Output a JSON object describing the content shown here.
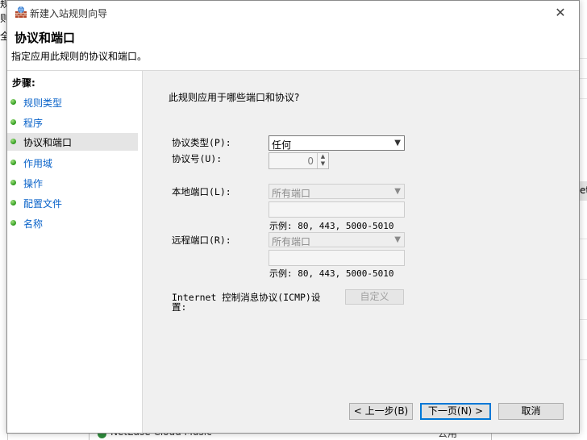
{
  "background": {
    "left_fragments": [
      "规",
      "则",
      "全"
    ],
    "right_fragment": "et",
    "bottom_app_name": "NetEase Cloud Music",
    "bottom_profile": "公用"
  },
  "dialog": {
    "title": "新建入站规则向导",
    "close_symbol": "✕",
    "header": {
      "title": "协议和端口",
      "description": "指定应用此规则的协议和端口。"
    },
    "steps": {
      "title": "步骤:",
      "items": [
        {
          "label": "规则类型"
        },
        {
          "label": "程序"
        },
        {
          "label": "协议和端口",
          "active": true
        },
        {
          "label": "作用域"
        },
        {
          "label": "操作"
        },
        {
          "label": "配置文件"
        },
        {
          "label": "名称"
        }
      ]
    },
    "content": {
      "question": "此规则应用于哪些端口和协议?",
      "protocol_type_label": "协议类型(P):",
      "protocol_type_value": "任何",
      "protocol_number_label": "协议号(U):",
      "protocol_number_value": "0",
      "local_port_label": "本地端口(L):",
      "local_port_value": "所有端口",
      "local_example": "示例: 80, 443, 5000-5010",
      "remote_port_label": "远程端口(R):",
      "remote_port_value": "所有端口",
      "remote_example": "示例: 80, 443, 5000-5010",
      "icmp_label_line1": "Internet 控制消息协议(ICMP)设",
      "icmp_label_line2": "置:",
      "customize_button": "自定义"
    },
    "buttons": {
      "back": "< 上一步(B)",
      "next": "下一页(N) >",
      "cancel": "取消"
    }
  }
}
